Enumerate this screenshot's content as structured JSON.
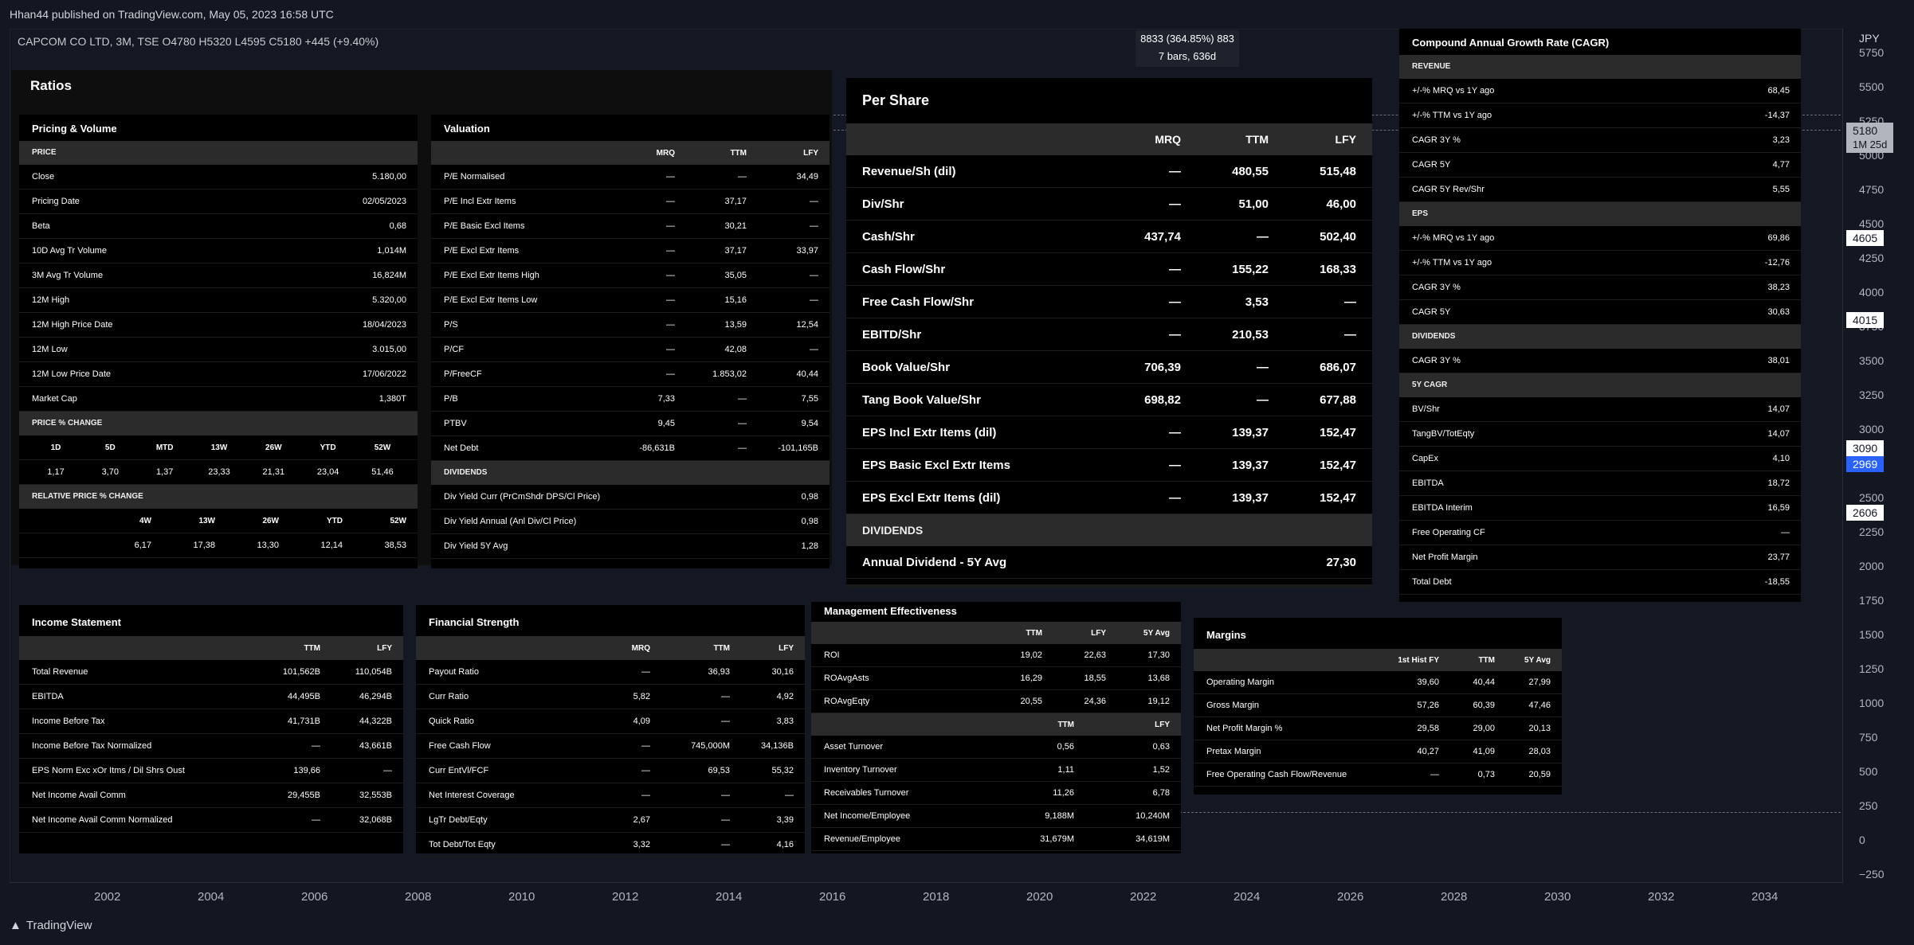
{
  "header": {
    "published": "Hhan44 published on TradingView.com, May 05, 2023 16:58 UTC",
    "symbol_line": "CAPCOM CO LTD, 3M, TSE  O4780  H5320  L4595  C5180  +445 (+9.40%)",
    "measure_line1": "8833 (364.85%) 883",
    "measure_line2": "7 bars, 636d"
  },
  "price_axis": {
    "currency": "JPY",
    "ticks": [
      "5750",
      "5500",
      "5250",
      "5000",
      "4750",
      "4500",
      "4250",
      "4000",
      "3750",
      "3500",
      "3250",
      "3000",
      "2750",
      "2500",
      "2250",
      "2000",
      "1750",
      "1500",
      "1250",
      "1000",
      "750",
      "500",
      "250",
      "0",
      "−250"
    ],
    "tags": [
      {
        "label": "5180",
        "sub": "1M 25d"
      },
      {
        "label": "4605"
      },
      {
        "label": "4015"
      },
      {
        "label": "3090"
      },
      {
        "label": "2969"
      },
      {
        "label": "2606"
      }
    ]
  },
  "time_axis": [
    "2002",
    "2004",
    "2006",
    "2008",
    "2010",
    "2012",
    "2014",
    "2016",
    "2018",
    "2020",
    "2022",
    "2024",
    "2026",
    "2028",
    "2030",
    "2032",
    "2034"
  ],
  "footer": {
    "brand": "TradingView"
  },
  "ratios": {
    "title": "Ratios"
  },
  "pricing": {
    "title": "Pricing & Volume",
    "price_section": "PRICE",
    "rows": [
      {
        "l": "Close",
        "v": "5.180,00"
      },
      {
        "l": "Pricing Date",
        "v": "02/05/2023"
      },
      {
        "l": "Beta",
        "v": "0,68"
      },
      {
        "l": "10D Avg Tr Volume",
        "v": "1,014M"
      },
      {
        "l": "3M Avg Tr Volume",
        "v": "16,824M"
      },
      {
        "l": "12M High",
        "v": "5.320,00"
      },
      {
        "l": "12M High Price Date",
        "v": "18/04/2023"
      },
      {
        "l": "12M Low",
        "v": "3.015,00"
      },
      {
        "l": "12M Low Price Date",
        "v": "17/06/2022"
      },
      {
        "l": "Market Cap",
        "v": "1,380T"
      }
    ],
    "pct_section": "PRICE % CHANGE",
    "pct_headers": [
      "1D",
      "5D",
      "MTD",
      "13W",
      "26W",
      "YTD",
      "52W"
    ],
    "pct_values": [
      "1,17",
      "3,70",
      "1,37",
      "23,33",
      "21,31",
      "23,04",
      "51,46"
    ],
    "rel_section": "RELATIVE PRICE % CHANGE",
    "rel_headers": [
      "4W",
      "13W",
      "26W",
      "YTD",
      "52W"
    ],
    "rel_values": [
      "6,17",
      "17,38",
      "13,30",
      "12,14",
      "38,53"
    ]
  },
  "valuation": {
    "title": "Valuation",
    "headers": [
      "MRQ",
      "TTM",
      "LFY"
    ],
    "rows": [
      {
        "l": "P/E Normalised",
        "a": "—",
        "b": "—",
        "c": "34,49"
      },
      {
        "l": "P/E Incl Extr Items",
        "a": "—",
        "b": "37,17",
        "c": "—"
      },
      {
        "l": "P/E Basic Excl Items",
        "a": "—",
        "b": "30,21",
        "c": "—"
      },
      {
        "l": "P/E Excl Extr Items",
        "a": "—",
        "b": "37,17",
        "c": "33,97"
      },
      {
        "l": "P/E Excl Extr Items High",
        "a": "—",
        "b": "35,05",
        "c": "—"
      },
      {
        "l": "P/E Excl Extr Items Low",
        "a": "—",
        "b": "15,16",
        "c": "—"
      },
      {
        "l": "P/S",
        "a": "—",
        "b": "13,59",
        "c": "12,54"
      },
      {
        "l": "P/CF",
        "a": "—",
        "b": "42,08",
        "c": "—"
      },
      {
        "l": "P/FreeCF",
        "a": "—",
        "b": "1.853,02",
        "c": "40,44"
      },
      {
        "l": "P/B",
        "a": "7,33",
        "b": "—",
        "c": "7,55"
      },
      {
        "l": "PTBV",
        "a": "9,45",
        "b": "—",
        "c": "9,54"
      },
      {
        "l": "Net Debt",
        "a": "-86,631B",
        "b": "—",
        "c": "-101,165B"
      }
    ],
    "div_section": "DIVIDENDS",
    "div_rows": [
      {
        "l": "Div Yield Curr (PrCmShdr DPS/Cl Price)",
        "v": "0,98"
      },
      {
        "l": "Div Yield Annual (Anl Div/Cl Price)",
        "v": "0,98"
      },
      {
        "l": "Div Yield 5Y Avg",
        "v": "1,28"
      }
    ]
  },
  "per_share": {
    "title": "Per Share",
    "headers": [
      "MRQ",
      "TTM",
      "LFY"
    ],
    "rows": [
      {
        "l": "Revenue/Sh (dil)",
        "a": "—",
        "b": "480,55",
        "c": "515,48"
      },
      {
        "l": "Div/Shr",
        "a": "—",
        "b": "51,00",
        "c": "46,00"
      },
      {
        "l": "Cash/Shr",
        "a": "437,74",
        "b": "—",
        "c": "502,40"
      },
      {
        "l": "Cash Flow/Shr",
        "a": "—",
        "b": "155,22",
        "c": "168,33"
      },
      {
        "l": "Free Cash Flow/Shr",
        "a": "—",
        "b": "3,53",
        "c": "—"
      },
      {
        "l": "EBITD/Shr",
        "a": "—",
        "b": "210,53",
        "c": "—"
      },
      {
        "l": "Book Value/Shr",
        "a": "706,39",
        "b": "—",
        "c": "686,07"
      },
      {
        "l": "Tang Book Value/Shr",
        "a": "698,82",
        "b": "—",
        "c": "677,88"
      },
      {
        "l": "EPS Incl Extr Items (dil)",
        "a": "—",
        "b": "139,37",
        "c": "152,47"
      },
      {
        "l": "EPS Basic Excl Extr Items",
        "a": "—",
        "b": "139,37",
        "c": "152,47"
      },
      {
        "l": "EPS Excl Extr Items (dil)",
        "a": "—",
        "b": "139,37",
        "c": "152,47"
      }
    ],
    "div_section": "DIVIDENDS",
    "div_row": {
      "l": "Annual Dividend - 5Y Avg",
      "v": "27,30"
    }
  },
  "cagr": {
    "title": "Compound Annual Growth Rate (CAGR)",
    "sections": [
      {
        "name": "REVENUE",
        "rows": [
          {
            "l": "+/-% MRQ vs 1Y ago",
            "v": "68,45"
          },
          {
            "l": "+/-% TTM vs 1Y ago",
            "v": "-14,37"
          },
          {
            "l": "CAGR 3Y %",
            "v": "3,23"
          },
          {
            "l": "CAGR 5Y",
            "v": "4,77"
          },
          {
            "l": "CAGR 5Y Rev/Shr",
            "v": "5,55"
          }
        ]
      },
      {
        "name": "EPS",
        "rows": [
          {
            "l": "+/-% MRQ vs 1Y ago",
            "v": "69,86"
          },
          {
            "l": "+/-% TTM vs 1Y ago",
            "v": "-12,76"
          },
          {
            "l": "CAGR 3Y %",
            "v": "38,23"
          },
          {
            "l": "CAGR 5Y",
            "v": "30,63"
          }
        ]
      },
      {
        "name": "DIVIDENDS",
        "rows": [
          {
            "l": "CAGR 3Y %",
            "v": "38,01"
          }
        ]
      },
      {
        "name": "5Y CAGR",
        "rows": [
          {
            "l": "BV/Shr",
            "v": "14,07"
          },
          {
            "l": "TangBV/TotEqty",
            "v": "14,07"
          },
          {
            "l": "CapEx",
            "v": "4,10"
          },
          {
            "l": "EBITDA",
            "v": "18,72"
          },
          {
            "l": "EBITDA Interim",
            "v": "16,59"
          },
          {
            "l": "Free Operating CF",
            "v": "—"
          },
          {
            "l": "Net Profit Margin",
            "v": "23,77"
          },
          {
            "l": "Total Debt",
            "v": "-18,55"
          }
        ]
      }
    ]
  },
  "income": {
    "title": "Income Statement",
    "headers": [
      "TTM",
      "LFY"
    ],
    "rows": [
      {
        "l": "Total Revenue",
        "a": "101,562B",
        "b": "110,054B"
      },
      {
        "l": "EBITDA",
        "a": "44,495B",
        "b": "46,294B"
      },
      {
        "l": "Income Before Tax",
        "a": "41,731B",
        "b": "44,322B"
      },
      {
        "l": "Income Before Tax Normalized",
        "a": "—",
        "b": "43,661B"
      },
      {
        "l": "EPS Norm Exc xOr Itms / Dil Shrs Oust",
        "a": "139,66",
        "b": "—"
      },
      {
        "l": "Net Income Avail Comm",
        "a": "29,455B",
        "b": "32,553B"
      },
      {
        "l": "Net Income Avail Comm Normalized",
        "a": "—",
        "b": "32,068B"
      }
    ]
  },
  "strength": {
    "title": "Financial Strength",
    "headers": [
      "MRQ",
      "TTM",
      "LFY"
    ],
    "rows": [
      {
        "l": "Payout Ratio",
        "a": "—",
        "b": "36,93",
        "c": "30,16"
      },
      {
        "l": "Curr Ratio",
        "a": "5,82",
        "b": "—",
        "c": "4,92"
      },
      {
        "l": "Quick Ratio",
        "a": "4,09",
        "b": "—",
        "c": "3,83"
      },
      {
        "l": "Free Cash Flow",
        "a": "—",
        "b": "745,000M",
        "c": "34,136B"
      },
      {
        "l": "Curr EntVl/FCF",
        "a": "—",
        "b": "69,53",
        "c": "55,32"
      },
      {
        "l": "Net Interest Coverage",
        "a": "—",
        "b": "—",
        "c": "—"
      },
      {
        "l": "LgTr Debt/Eqty",
        "a": "2,67",
        "b": "—",
        "c": "3,39"
      },
      {
        "l": "Tot Debt/Tot Eqty",
        "a": "3,32",
        "b": "—",
        "c": "4,16"
      }
    ]
  },
  "mgmt": {
    "title": "Management Effectiveness",
    "headers": [
      "TTM",
      "LFY",
      "5Y Avg"
    ],
    "rows": [
      {
        "l": "ROI",
        "a": "19,02",
        "b": "22,63",
        "c": "17,30"
      },
      {
        "l": "ROAvgAsts",
        "a": "16,29",
        "b": "18,55",
        "c": "13,68"
      },
      {
        "l": "ROAvgEqty",
        "a": "20,55",
        "b": "24,36",
        "c": "19,12"
      }
    ],
    "headers2": [
      "TTM",
      "LFY"
    ],
    "rows2": [
      {
        "l": "Asset Turnover",
        "a": "0,56",
        "b": "0,63"
      },
      {
        "l": "Inventory Turnover",
        "a": "1,11",
        "b": "1,52"
      },
      {
        "l": "Receivables Turnover",
        "a": "11,26",
        "b": "6,78"
      },
      {
        "l": "Net Income/Employee",
        "a": "9,188M",
        "b": "10,240M"
      },
      {
        "l": "Revenue/Employee",
        "a": "31,679M",
        "b": "34,619M"
      }
    ]
  },
  "margins": {
    "title": "Margins",
    "headers": [
      "1st Hist FY",
      "TTM",
      "5Y Avg"
    ],
    "rows": [
      {
        "l": "Operating Margin",
        "a": "39,60",
        "b": "40,44",
        "c": "27,99"
      },
      {
        "l": "Gross Margin",
        "a": "57,26",
        "b": "60,39",
        "c": "47,46"
      },
      {
        "l": "Net Profit Margin %",
        "a": "29,58",
        "b": "29,00",
        "c": "20,13"
      },
      {
        "l": "Pretax Margin",
        "a": "40,27",
        "b": "41,09",
        "c": "28,03"
      },
      {
        "l": "Free Operating Cash Flow/Revenue",
        "a": "—",
        "b": "0,73",
        "c": "20,59"
      }
    ]
  }
}
